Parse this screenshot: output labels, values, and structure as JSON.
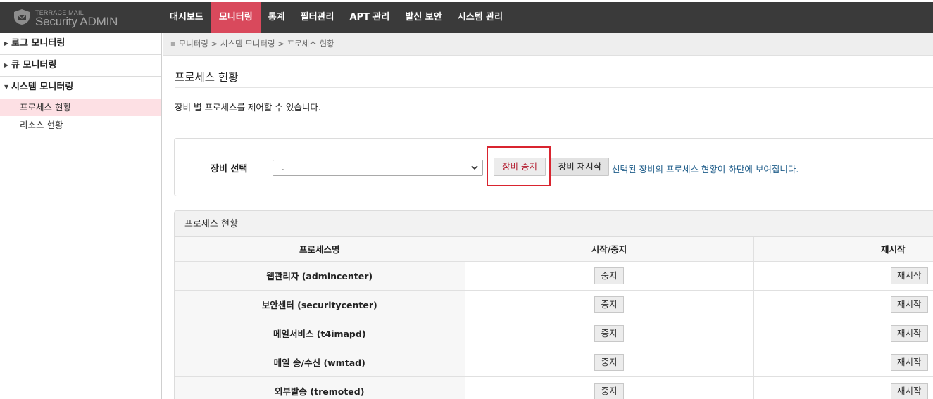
{
  "app": {
    "brand_small": "TERRACE MAIL",
    "brand_big": "Security ADMIN",
    "accent_color": "#d9495c",
    "topbar_color": "#3a3a3a"
  },
  "nav": {
    "items": [
      {
        "label": "대시보드",
        "active": false
      },
      {
        "label": "모니터링",
        "active": true
      },
      {
        "label": "통계",
        "active": false
      },
      {
        "label": "필터관리",
        "active": false
      },
      {
        "label": "APT 관리",
        "active": false
      },
      {
        "label": "발신 보안",
        "active": false
      },
      {
        "label": "시스템 관리",
        "active": false
      }
    ]
  },
  "sidebar": {
    "groups": [
      {
        "label": "로그 모니터링",
        "expanded": false
      },
      {
        "label": "큐 모니터링",
        "expanded": false
      },
      {
        "label": "시스템 모니터링",
        "expanded": true
      }
    ],
    "sub_items": [
      {
        "label": "프로세스 현황",
        "active": true
      },
      {
        "label": "리소스 현황",
        "active": false
      }
    ]
  },
  "breadcrumb": "모니터링 > 시스템 모니터링 > 프로세스 현황",
  "page": {
    "title": "프로세스 현황",
    "description": "장비 별 프로세스를 제어할 수 있습니다."
  },
  "device_select": {
    "label": "장비 선택",
    "selected_value": ".",
    "stop_button": "장비 중지",
    "restart_button": "장비 재시작",
    "hint": "선택된 장비의 프로세스 현황이 하단에 보여집니다."
  },
  "process_table": {
    "panel_title": "프로세스 현황",
    "columns": [
      "프로세스명",
      "시작/중지",
      "재시작"
    ],
    "rows": [
      {
        "name": "웹관리자 (admincenter)",
        "toggle": "중지",
        "restart": "재시작"
      },
      {
        "name": "보안센터 (securitycenter)",
        "toggle": "중지",
        "restart": "재시작"
      },
      {
        "name": "메일서비스 (t4imapd)",
        "toggle": "중지",
        "restart": "재시작"
      },
      {
        "name": "메일 송/수신 (wmtad)",
        "toggle": "중지",
        "restart": "재시작"
      },
      {
        "name": "외부발송 (tremoted)",
        "toggle": "중지",
        "restart": "재시작"
      }
    ]
  },
  "icons": {
    "logo": "envelope-shield-icon",
    "caret_collapsed": "caret-right-icon",
    "caret_expanded": "caret-down-icon",
    "select_chevron": "chevron-down-icon",
    "breadcrumb_bullet": "bullet-icon"
  }
}
